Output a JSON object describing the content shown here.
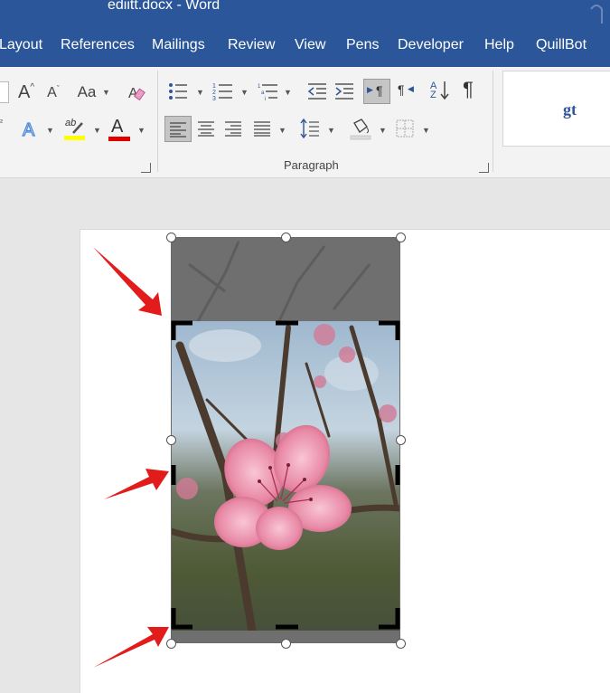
{
  "window": {
    "title": "ediitt.docx  -  Word"
  },
  "tabs": [
    {
      "label": "Layout"
    },
    {
      "label": "References"
    },
    {
      "label": "Mailings"
    },
    {
      "label": "Review"
    },
    {
      "label": "View"
    },
    {
      "label": "Pens"
    },
    {
      "label": "Developer"
    },
    {
      "label": "Help"
    },
    {
      "label": "QuillBot"
    }
  ],
  "ribbon": {
    "font": {
      "change_case_label": "Aa",
      "grow_label": "A",
      "shrink_label": "A",
      "text_effects_label": "A",
      "font_color_label": "A",
      "highlight_label": "ab"
    },
    "paragraph": {
      "group_label": "Paragraph",
      "sort_label": "AZ",
      "pilcrow_label": "¶",
      "ltr_label": "¶",
      "rtl_label": "¶"
    },
    "styles": {
      "sample": "gt"
    }
  },
  "colors": {
    "title_bar": "#2b579a",
    "highlight": "#ffff00",
    "font_color": "#e00000",
    "annotation_arrow": "#e21b1b"
  }
}
